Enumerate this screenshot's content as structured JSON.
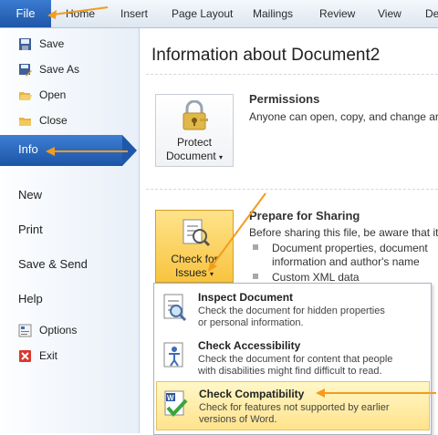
{
  "ribbon": {
    "file_tab": "File",
    "tabs": [
      "Home",
      "Insert",
      "Page Layout",
      "Mailings",
      "Review",
      "View",
      "De"
    ]
  },
  "sidebar": {
    "items": [
      {
        "label": "Save",
        "icon": "save-icon"
      },
      {
        "label": "Save As",
        "icon": "save-as-icon"
      },
      {
        "label": "Open",
        "icon": "open-folder-icon"
      },
      {
        "label": "Close",
        "icon": "close-folder-icon"
      }
    ],
    "selected": "Info",
    "main_items": [
      "New",
      "Print",
      "Save & Send",
      "Help"
    ],
    "bottom_items": [
      {
        "label": "Options",
        "icon": "options-icon"
      },
      {
        "label": "Exit",
        "icon": "exit-icon"
      }
    ]
  },
  "main": {
    "heading": "Information about Document2",
    "permissions": {
      "button_line1": "Protect",
      "button_line2": "Document",
      "title": "Permissions",
      "text": "Anyone can open, copy, and change ar"
    },
    "sharing": {
      "button_line1": "Check for",
      "button_line2": "Issues",
      "title": "Prepare for Sharing",
      "text": "Before sharing this file, be aware that it",
      "bullets": [
        {
          "line1": "Document properties, document",
          "line2": "information and author's name"
        },
        {
          "line1": "Custom XML data",
          "line2": ""
        }
      ]
    }
  },
  "menu": {
    "items": [
      {
        "title": "Inspect Document",
        "line1": "Check the document for hidden properties",
        "line2": "or personal information."
      },
      {
        "title": "Check Accessibility",
        "line1": "Check the document for content that people",
        "line2": "with disabilities might find difficult to read."
      },
      {
        "title": "Check Compatibility",
        "line1": "Check for features not supported by earlier",
        "line2": "versions of Word."
      }
    ]
  },
  "colors": {
    "accent": "#1f56a8",
    "arrow": "#f39c1e",
    "highlight": "#ffe38b"
  }
}
